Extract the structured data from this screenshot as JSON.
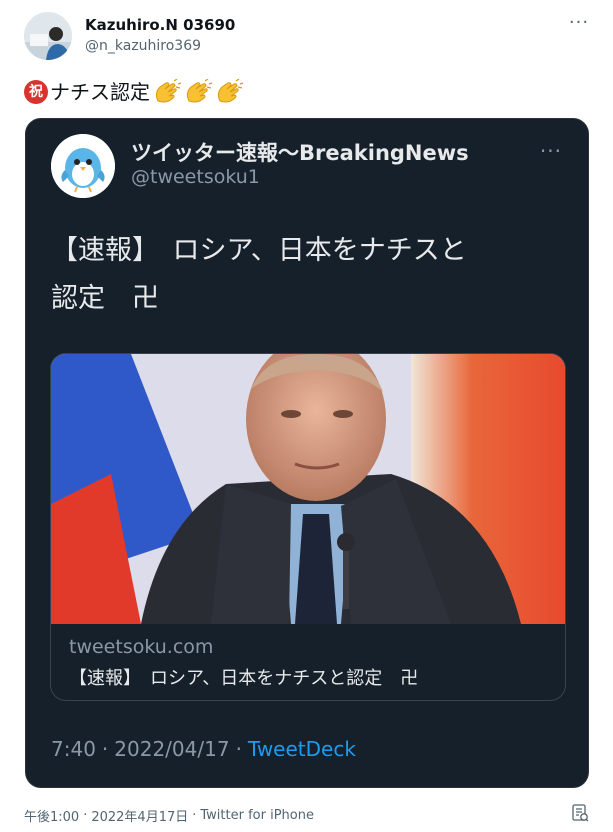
{
  "author": {
    "display_name": "Kazuhiro.N 03690",
    "handle": "@n_kazuhiro369"
  },
  "tweet": {
    "badge_char": "祝",
    "text": "ナチス認定",
    "emoji": [
      "clapping-hands",
      "clapping-hands",
      "clapping-hands"
    ]
  },
  "embedded_tweet": {
    "display_name": "ツイッター速報〜BreakingNews",
    "handle": "@tweetsoku1",
    "text": "【速報】　ロシア、日本をナチスと\n認定　卍",
    "link_card": {
      "domain": "tweetsoku.com",
      "title": "【速報】　ロシア、日本をナチスと認定　卍"
    },
    "time": "7:40",
    "date": "2022/04/17",
    "source": "TweetDeck"
  },
  "footer": {
    "time": "午後1:00",
    "date": "2022年4月17日",
    "source": "Twitter for iPhone"
  },
  "colors": {
    "embed_background": "#15202b",
    "link_blue": "#1d9bf0",
    "badge_red": "#d9332e"
  }
}
